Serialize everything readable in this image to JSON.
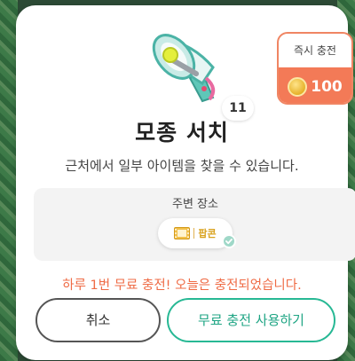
{
  "item": {
    "name": "모종 서치",
    "count": "11",
    "description": "근처에서 일부 아이템을 찾을 수 있습니다."
  },
  "instant_charge": {
    "label": "즉시 충전",
    "price": "100"
  },
  "location": {
    "title": "주변 장소",
    "chip_label": "팝콘"
  },
  "notice": "하루 1번 무료 충전! 오늘은 충전되었습니다.",
  "buttons": {
    "cancel": "취소",
    "use_free": "무료 충전 사용하기"
  },
  "colors": {
    "accent_orange": "#f37a57",
    "accent_green": "#27b894",
    "chip_gold": "#d9a21e"
  }
}
